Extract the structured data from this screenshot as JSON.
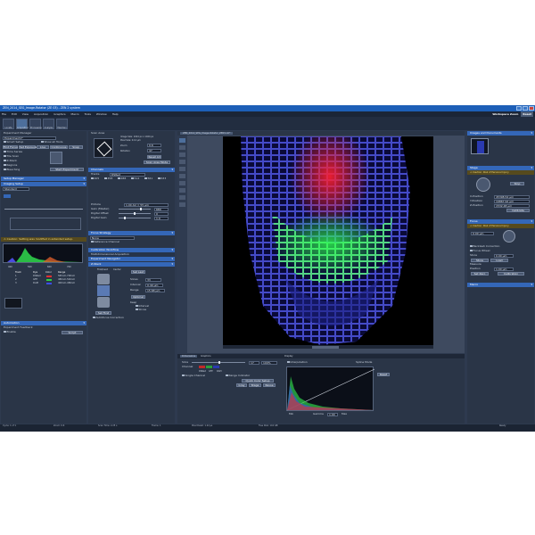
{
  "window": {
    "title": "ZEN_2014_SEG_Image-Rotator (ZE 03) - ZEN 2 system"
  },
  "menu": {
    "items": [
      "File",
      "Edit",
      "View",
      "Acquisition",
      "Graphics",
      "Macro",
      "Tools",
      "Window",
      "Help"
    ],
    "workspace_label": "Workspace Zoom",
    "reset_label": "Reset"
  },
  "toolbar": {
    "tabs": [
      "Locate",
      "Acquisition",
      "Processing",
      "Analysis",
      "Maintain"
    ],
    "sub": [
      "Smart Setup",
      "Show all Tools"
    ],
    "actions": [
      "Find Focus",
      "Set Exposure",
      "Live",
      "Continuous",
      "Snap"
    ]
  },
  "left": {
    "experiment_manager": "Experiment Manager",
    "experiment_value": "Experiment1*",
    "checks": [
      "Time Series",
      "Tile Scan",
      "Z-Stack",
      "Regions",
      "Bleaching"
    ],
    "start_label": "Start Experiment",
    "setup_manager": "Setup Manager",
    "imaging_setup": "Imaging Setup",
    "imaging_value": "Standard",
    "caution_text": "Caution: Setting was modified in extended setup.",
    "spectrum_ticks": [
      "400",
      "500",
      "600",
      "700"
    ],
    "track_table": {
      "headers": [
        "Track",
        "Dye",
        "Color",
        "Range"
      ],
      "rows": [
        [
          "1",
          "DSRed",
          "",
          "565nm-700nm"
        ],
        [
          "2",
          "GFP",
          "",
          "480nm-540nm"
        ],
        [
          "3",
          "DAPI",
          "",
          "400nm-480nm"
        ]
      ]
    },
    "automation": "Automation",
    "auto_value": "Experiment Feedback",
    "enable_label": "Enable",
    "script_label": "Script"
  },
  "mid": {
    "scan_area": "Scan Area",
    "image_size": "Image Size: 1024 px x 1024 px",
    "pixel_size": "Pixel Size: 0.12 µm",
    "zoom_label": "Zoom",
    "zoom_value": "0.6",
    "rotation_label": "Rotation",
    "rotation_value": "47",
    "reset_all": "Reset All",
    "scan_mode_btn": "Scan Area Mode",
    "channels": "Channels",
    "tracks_label": "Tracks",
    "lasers": [
      "405",
      "458",
      "488",
      "514",
      "561",
      "633"
    ],
    "pinhole_label": "Pinhole",
    "pinhole_value": "1.00 AU = 55 µm",
    "gain_label": "Gain (Master)",
    "gain_value": "680",
    "offset_label": "Digital Offset",
    "offset_value": "0",
    "digital_gain_label": "Digital Gain",
    "digital_gain_value": "1.0",
    "acquisition_mode": "Acquisition Mode",
    "focus_strategy": "Focus Strategy",
    "none": "None",
    "reference_channel": "Reference Channel",
    "calibrate": "Calibration Workflow",
    "multidim": "Multidimensional Acquisition",
    "exp_navigator": "Experiment Navigator",
    "z_stack": "Z-Stack",
    "first_last": "First/Last",
    "center": "Center",
    "set_last": "Set Last",
    "set_first": "Set First",
    "slices_label": "Slices",
    "slices_value": "33",
    "interval_label": "Interval",
    "interval_value": "0.49 µm",
    "range_label": "Range",
    "range_value": "15.68 µm",
    "optimal": "Optimal",
    "keep": "Keep",
    "interval_opt": "Interval",
    "slices_opt": "Slices",
    "autofocus": "Autofocus Correction"
  },
  "viewer": {
    "doc_tab": "ZEN_2014_SEG_Image-Rotator_ZE03.czi*",
    "dimensions_tab": "Dimensions",
    "display_tab": "Display",
    "graphics_tab": "Graphics",
    "channel_labels": [
      "DSRed",
      "GFP",
      "DAPI"
    ],
    "single_channel": "Single Channel",
    "range_indicator": "Range Indicator",
    "quick_color": "Quick Color Setup",
    "gray": "Gray",
    "stage": "Stage",
    "reuse": "Reuse",
    "min_label": "Min",
    "max_label": "Max",
    "gamma_label": "Gamma",
    "gamma_value": "1.00",
    "zoom_value": "100%",
    "image_slider_label": "Slice",
    "slice_value": "17",
    "interpolation": "Interpolation",
    "spline_mode": "Spline Mode",
    "reset_btn": "Reset",
    "channel_label": "Channel"
  },
  "right": {
    "images_docs": "Images and Documents",
    "design": "Design",
    "workspace": "Workspace",
    "stage": "Stage",
    "caution_stage": "Caution: Risk of Personal Injury",
    "stop": "Stop",
    "x_label": "X-Position",
    "x_value": "45398.54 µm",
    "y_label": "Y-Position",
    "y_value": "19867.92 µm",
    "z_label": "Z-Position",
    "z_value": "1532.48 µm",
    "calibrate": "Calibrate",
    "focus": "Focus",
    "caution_focus": "Caution: Risk of Personal Injury",
    "focus_value": "0.00 µm",
    "backlash": "Backlash Correction",
    "focus_wheel": "Focus Wheel",
    "store_label": "Store",
    "store_value": "0.00 µm",
    "measure_label": "Measure",
    "load": "Load",
    "objective_label": "Position",
    "objective_value": "1.00 µm",
    "set_zero": "Set Zero",
    "calibration": "Calibration",
    "macro": "Macro"
  },
  "status": {
    "items": [
      "Cycle: 1 of 1",
      "Zoom: 0.6",
      "Scan Time: 2.25 s",
      "Frame: 1",
      "Pixel Dwell: 1.22 µs",
      "Free Disk: 142 GB",
      "Ready"
    ]
  },
  "colors": {
    "panel_header": "#3467b8",
    "app_bg": "#2e3a4f",
    "title_bar": "#1d5fb7"
  }
}
